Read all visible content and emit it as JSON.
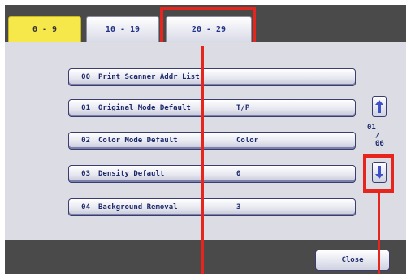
{
  "tabs": [
    {
      "label": "0 - 9"
    },
    {
      "label": "10 - 19"
    },
    {
      "label": "20 - 29"
    }
  ],
  "rows": [
    {
      "num": "00",
      "name": "Print Scanner Addr List",
      "value": ""
    },
    {
      "num": "01",
      "name": "Original Mode Default",
      "value": "T/P"
    },
    {
      "num": "02",
      "name": "Color Mode Default",
      "value": "Color"
    },
    {
      "num": "03",
      "name": "Density Default",
      "value": "0"
    },
    {
      "num": "04",
      "name": "Background Removal",
      "value": "3"
    }
  ],
  "pager": {
    "current": "01",
    "separator": "/",
    "total": "06"
  },
  "footer": {
    "close_label": "Close"
  },
  "colors": {
    "highlight": "#e8251d",
    "selected_tab": "#f6e84a",
    "bar": "#4a4a4a",
    "panel": "#dcdde4",
    "text": "#1f2a6a"
  },
  "icons": {
    "scroll_up": "arrow-up-icon",
    "scroll_down": "arrow-down-icon"
  }
}
